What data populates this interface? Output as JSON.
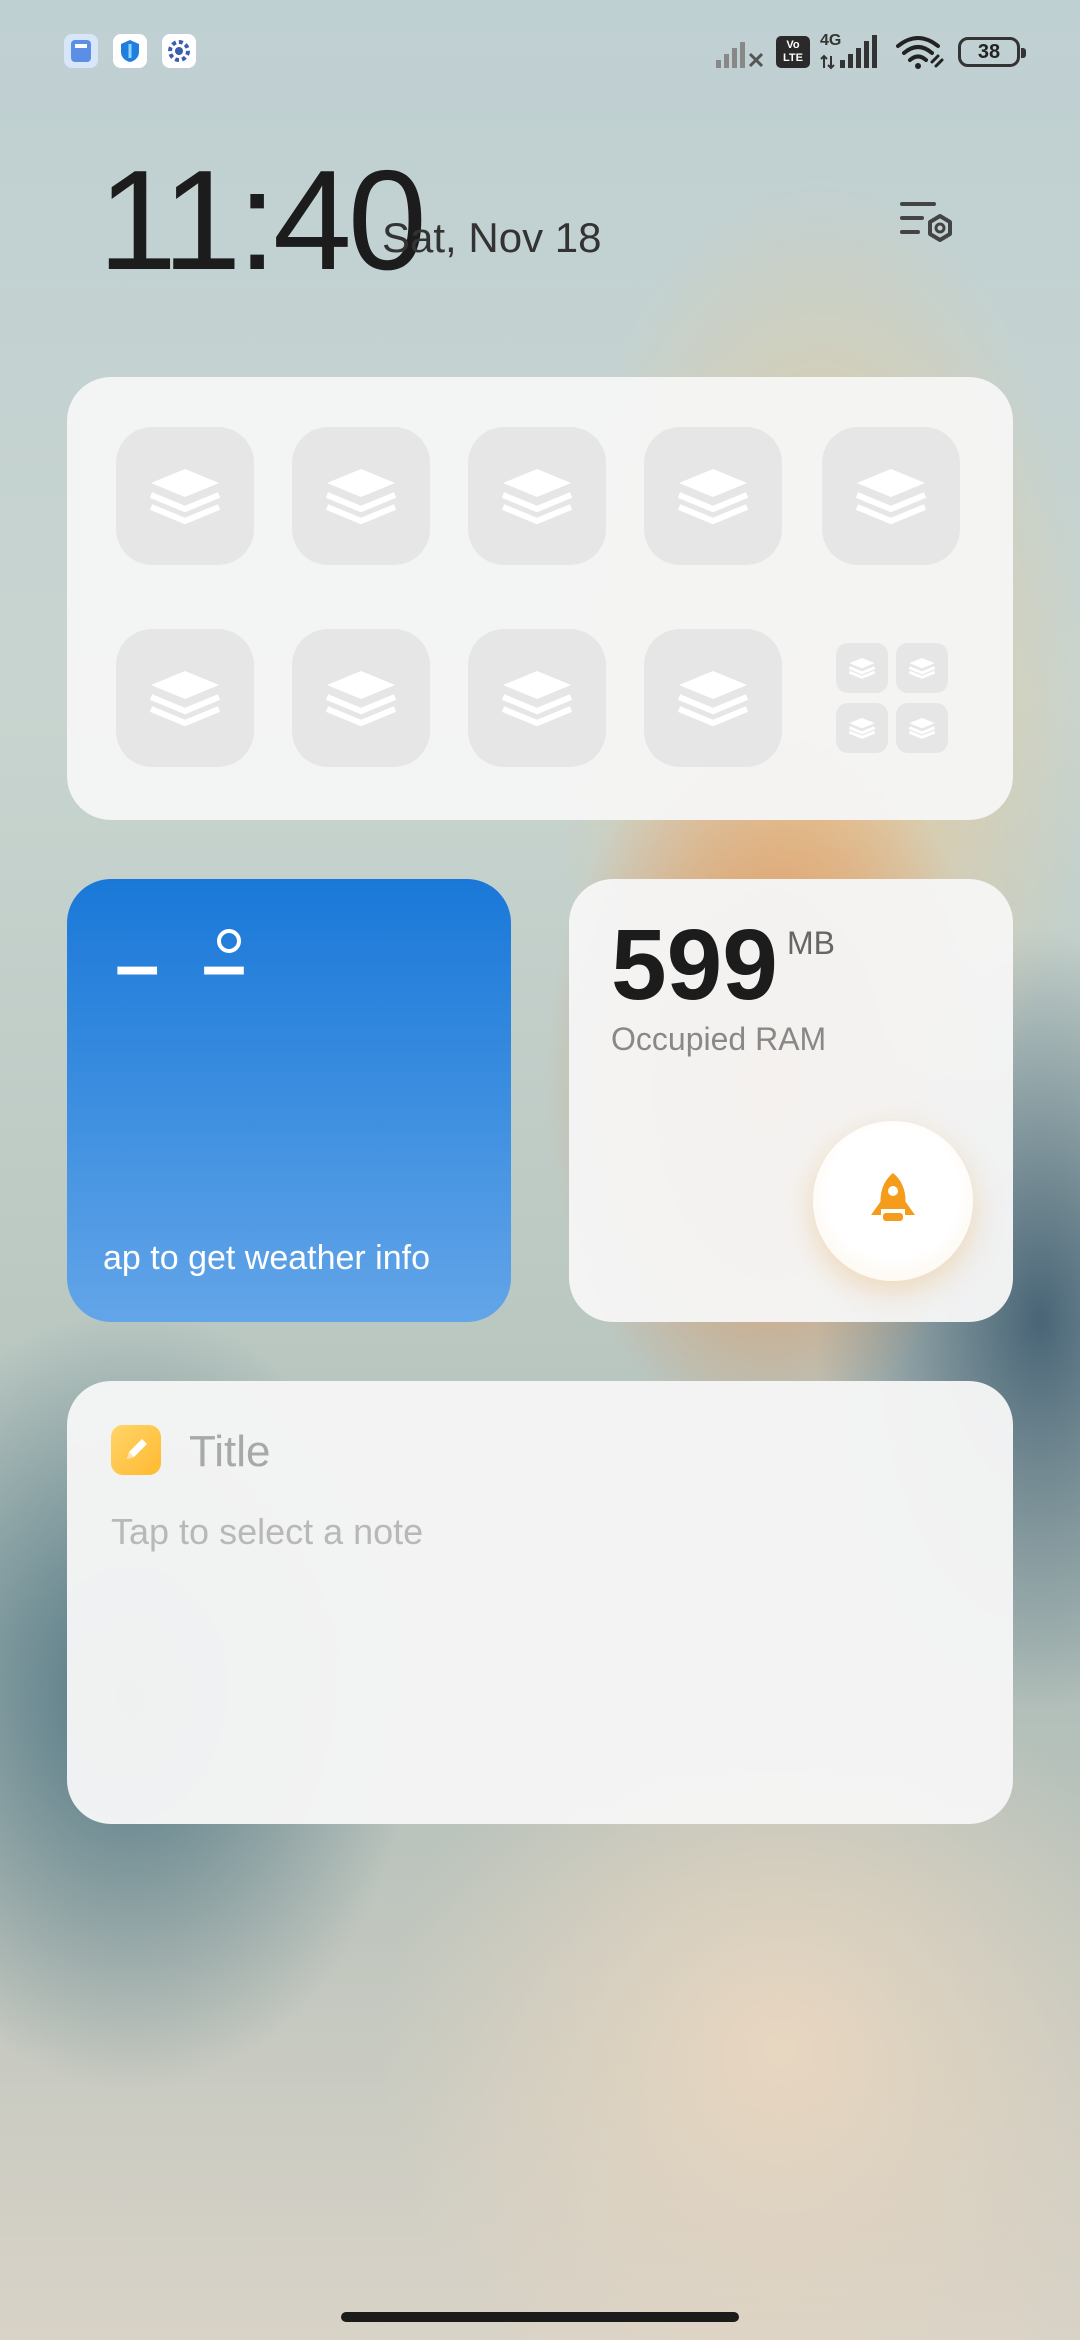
{
  "status_bar": {
    "notifications": [
      "cleaner-app-icon",
      "security-app-icon",
      "settings-app-icon"
    ],
    "volte_label": "Vo LTE",
    "network_label": "4G",
    "battery_level": "38"
  },
  "header": {
    "time": "11:40",
    "date": "Sat, Nov 18"
  },
  "quick_settings": {
    "tile_count": 9,
    "tile_icon": "layers-icon"
  },
  "weather": {
    "temperature": "– –",
    "hint": "ap to get weather info",
    "color": "#1a78d8"
  },
  "ram": {
    "value": "599",
    "unit": "MB",
    "label": "Occupied RAM",
    "boost_icon": "rocket-icon",
    "accent": "#f59c1a"
  },
  "notes": {
    "title": "Title",
    "hint": "Tap to select a note",
    "accent": "#ffc23d"
  }
}
